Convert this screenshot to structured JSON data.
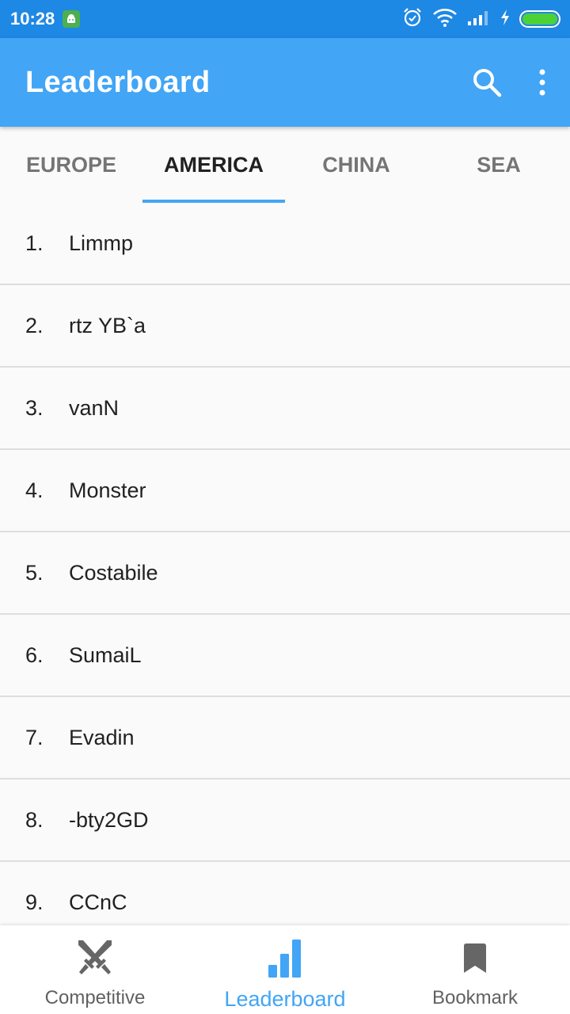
{
  "status_bar": {
    "time": "10:28"
  },
  "app_bar": {
    "title": "Leaderboard"
  },
  "tabs": [
    {
      "label": "EUROPE",
      "active": false
    },
    {
      "label": "AMERICA",
      "active": true
    },
    {
      "label": "CHINA",
      "active": false
    },
    {
      "label": "SEA",
      "active": false
    }
  ],
  "leaderboard": [
    {
      "rank": "1.",
      "name": "Limmp"
    },
    {
      "rank": "2.",
      "name": "rtz YB`a"
    },
    {
      "rank": "3.",
      "name": "vanN"
    },
    {
      "rank": "4.",
      "name": "Monster"
    },
    {
      "rank": "5.",
      "name": "Costabile"
    },
    {
      "rank": "6.",
      "name": "SumaiL"
    },
    {
      "rank": "7.",
      "name": "Evadin"
    },
    {
      "rank": "8.",
      "name": "-bty2GD"
    },
    {
      "rank": "9.",
      "name": "CCnC"
    }
  ],
  "bottom_nav": [
    {
      "label": "Competitive",
      "icon": "crossed-swords-icon",
      "active": false
    },
    {
      "label": "Leaderboard",
      "icon": "bar-chart-icon",
      "active": true
    },
    {
      "label": "Bookmark",
      "icon": "bookmark-icon",
      "active": false
    }
  ],
  "colors": {
    "status_bar": "#1e88e5",
    "app_bar": "#42a5f5",
    "accent": "#42a5f5",
    "battery": "#4cd137"
  }
}
